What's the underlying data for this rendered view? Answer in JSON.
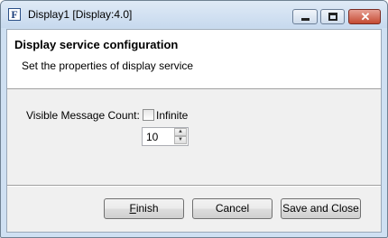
{
  "window": {
    "title": "Display1 [Display:4.0]",
    "icon": "app-f-icon"
  },
  "header": {
    "title": "Display service configuration",
    "description": "Set the properties of display service"
  },
  "form": {
    "visible_message_count_label": "Visible Message Count:",
    "infinite_label": "Infinite",
    "infinite_checked": false,
    "count_value": "10"
  },
  "buttons": {
    "finish_mnemonic": "F",
    "finish_rest": "inish",
    "cancel": "Cancel",
    "save_and_close": "Save and Close"
  },
  "titlebar_controls": {
    "minimize": "minimize-icon",
    "maximize": "maximize-icon",
    "close": "close-icon"
  }
}
